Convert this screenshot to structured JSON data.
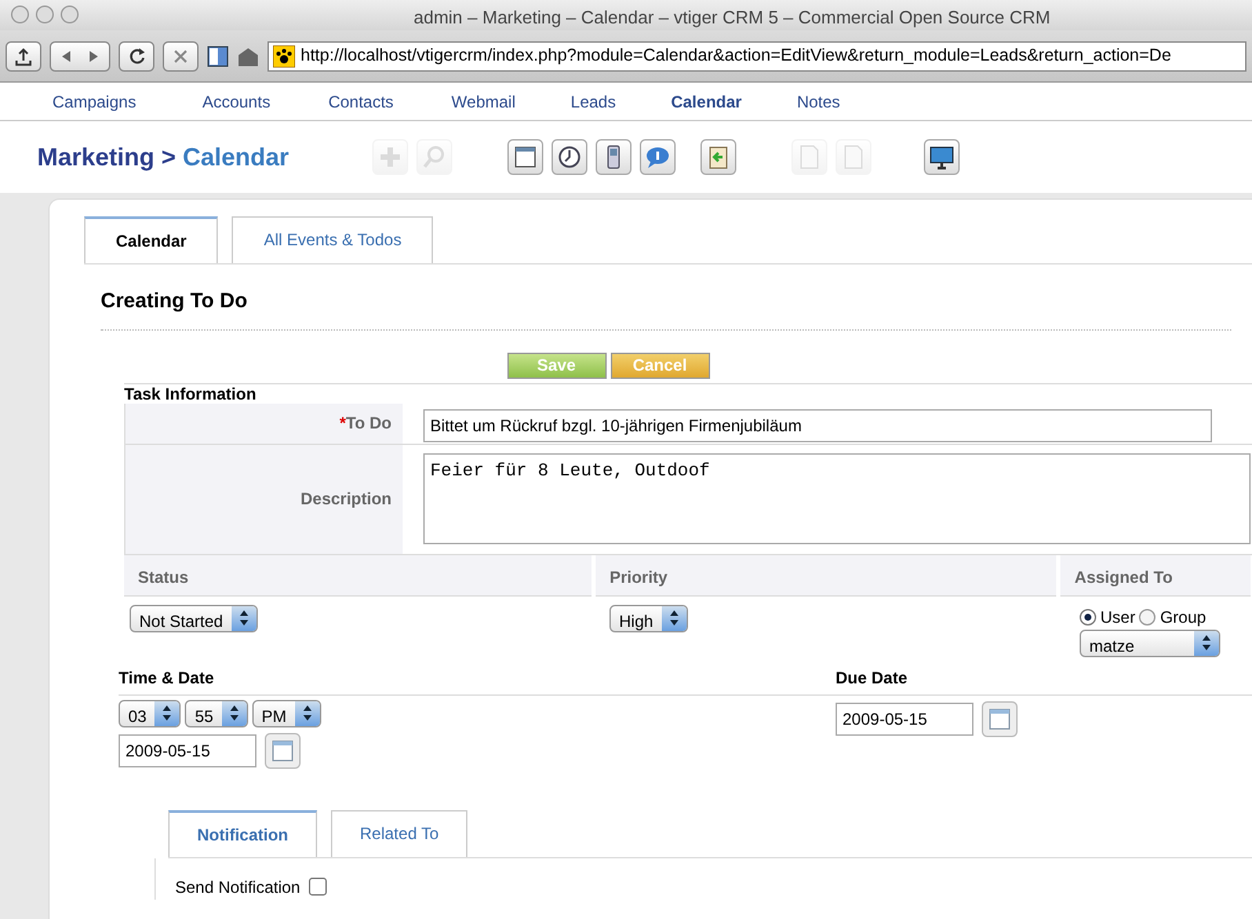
{
  "window": {
    "title": "admin – Marketing – Calendar – vtiger CRM 5 – Commercial Open Source CRM"
  },
  "browser": {
    "url": "http://localhost/vtigercrm/index.php?module=Calendar&action=EditView&return_module=Leads&return_action=De"
  },
  "nav": [
    {
      "label": "Campaigns",
      "selected": false
    },
    {
      "label": "Accounts",
      "selected": false
    },
    {
      "label": "Contacts",
      "selected": false
    },
    {
      "label": "Webmail",
      "selected": false
    },
    {
      "label": "Leads",
      "selected": false
    },
    {
      "label": "Calendar",
      "selected": true
    },
    {
      "label": "Notes",
      "selected": false
    }
  ],
  "breadcrumb": {
    "section": "Marketing",
    "separator": ">",
    "module": "Calendar"
  },
  "toolbar": [
    {
      "kind": "plus",
      "disabled": true
    },
    {
      "kind": "search",
      "disabled": true
    },
    {
      "kind": "calendar",
      "disabled": false
    },
    {
      "kind": "clock",
      "disabled": false
    },
    {
      "kind": "phone",
      "disabled": false
    },
    {
      "kind": "chat",
      "disabled": false
    },
    {
      "kind": "clipboard",
      "disabled": false
    },
    {
      "kind": "document",
      "disabled": true
    },
    {
      "kind": "document",
      "disabled": true
    },
    {
      "kind": "monitor",
      "disabled": false
    }
  ],
  "tabs": [
    {
      "label": "Calendar",
      "selected": true
    },
    {
      "label": "All Events & Todos",
      "selected": false
    }
  ],
  "heading": "Creating To Do",
  "buttons": [
    {
      "kind": "save",
      "label": "Save"
    },
    {
      "kind": "cancel",
      "label": "Cancel"
    }
  ],
  "section_title": "Task Information",
  "todo": {
    "required_mark": "*",
    "label": "To Do",
    "value": "Bittet um Rückruf bzgl. 10-jährigen Firmenjubiläum"
  },
  "description": {
    "label": "Description",
    "value": "Feier für 8 Leute, Outdoof"
  },
  "status": {
    "label": "Status",
    "value": "Not Started"
  },
  "priority": {
    "label": "Priority",
    "value": "High"
  },
  "assigned": {
    "label": "Assigned To",
    "options": [
      {
        "label": "User",
        "selected": true
      },
      {
        "label": "Group",
        "selected": false
      }
    ],
    "value": "matze"
  },
  "time_date": {
    "label": "Time & Date",
    "hour": "03",
    "minute": "55",
    "ampm": "PM",
    "date": "2009-05-15"
  },
  "due_date": {
    "label": "Due Date",
    "date": "2009-05-15"
  },
  "bottom_tabs": [
    {
      "label": "Notification",
      "selected": true
    },
    {
      "label": "Related To",
      "selected": false
    }
  ],
  "send_notification": {
    "label": "Send Notification",
    "checked": false
  }
}
